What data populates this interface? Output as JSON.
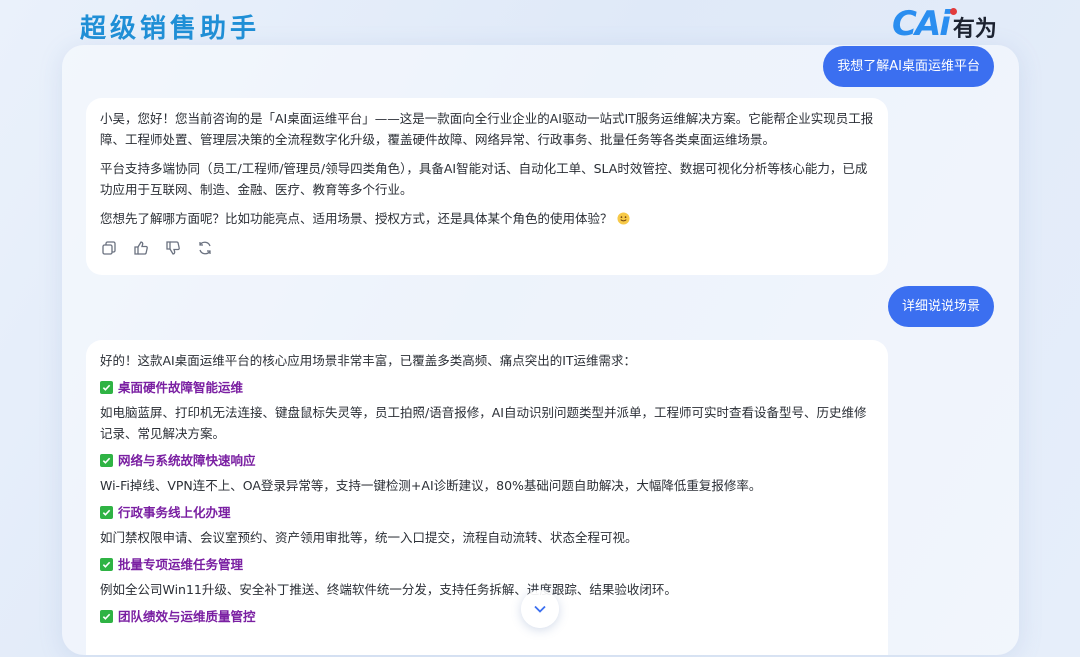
{
  "header": {
    "app_title": "超级销售助手",
    "brand_mark": "CAi",
    "brand_text": "有为"
  },
  "conversation": {
    "user_message_1": "我想了解AI桌面运维平台",
    "ai_reply_1": {
      "paragraphs": [
        "小吴，您好！您当前咨询的是「AI桌面运维平台」——这是一款面向全行业企业的AI驱动一站式IT服务运维解决方案。它能帮企业实现员工报障、工程师处置、管理层决策的全流程数字化升级，覆盖硬件故障、网络异常、行政事务、批量任务等各类桌面运维场景。",
        "平台支持多端协同（员工/工程师/管理员/领导四类角色），具备AI智能对话、自动化工单、SLA时效管控、数据可视化分析等核心能力，已成功应用于互联网、制造、金融、医疗、教育等多个行业。",
        "您想先了解哪方面呢？比如功能亮点、适用场景、授权方式，还是具体某个角色的使用体验？"
      ],
      "emoji": "smile-emoji",
      "actions": [
        "copy-icon",
        "thumbs-up-icon",
        "thumbs-down-icon",
        "regenerate-icon"
      ]
    },
    "user_message_2": "详细说说场景",
    "ai_reply_2": {
      "intro": "好的！这款AI桌面运维平台的核心应用场景非常丰富，已覆盖多类高频、痛点突出的IT运维需求：",
      "sections": [
        {
          "title": "桌面硬件故障智能运维",
          "body": "如电脑蓝屏、打印机无法连接、键盘鼠标失灵等，员工拍照/语音报修，AI自动识别问题类型并派单，工程师可实时查看设备型号、历史维修记录、常见解决方案。"
        },
        {
          "title": "网络与系统故障快速响应",
          "body": "Wi-Fi掉线、VPN连不上、OA登录异常等，支持一键检测+AI诊断建议，80%基础问题自助解决，大幅降低重复报修率。"
        },
        {
          "title": "行政事务线上化办理",
          "body": "如门禁权限申请、会议室预约、资产领用审批等，统一入口提交，流程自动流转、状态全程可视。"
        },
        {
          "title": "批量专项运维任务管理",
          "body": "例如全公司Win11升级、安全补丁推送、终端软件统一分发，支持任务拆解、进度跟踪、结果验收闭环。"
        },
        {
          "title": "团队绩效与运维质量管控",
          "body": ""
        }
      ]
    }
  },
  "colors": {
    "accent": "#3b6ff0",
    "section_title": "#7a1fa2",
    "check": "#2fb344",
    "app_title": "#1f8fd6"
  }
}
